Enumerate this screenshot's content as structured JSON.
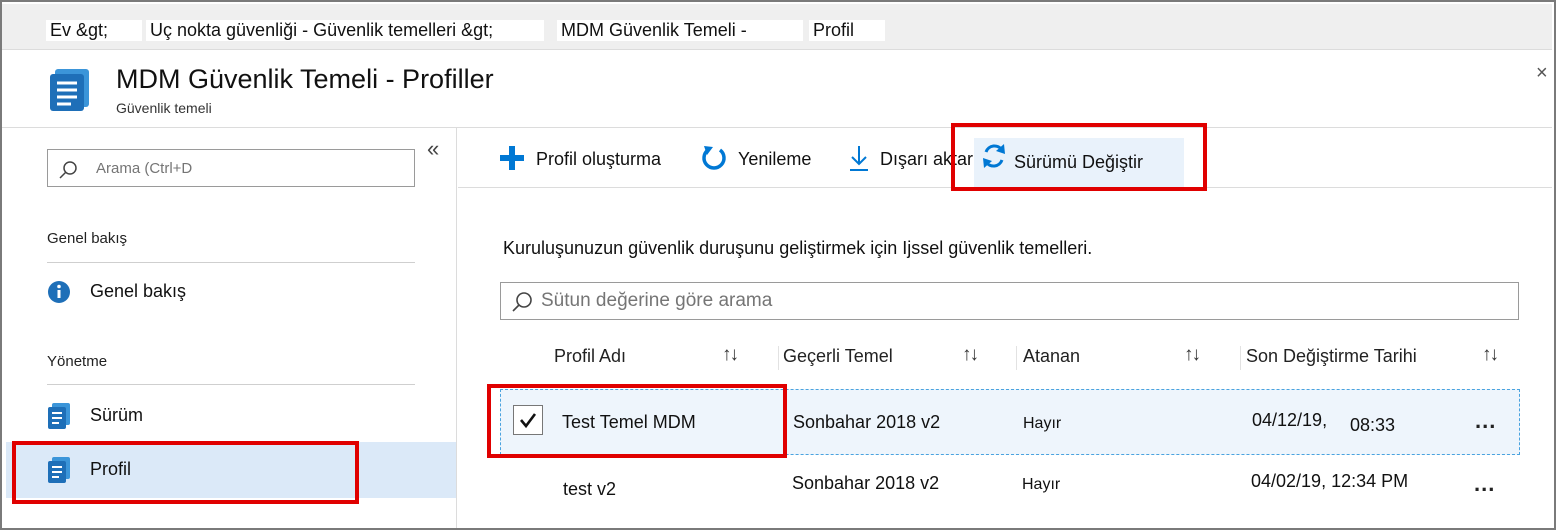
{
  "breadcrumb": {
    "home": "Ev &gt;",
    "endpoint": "Uç nokta güvenliği - Güvenlik temelleri &gt;",
    "baseline": "MDM Güvenlik Temeli -",
    "profile": "Profil"
  },
  "header": {
    "title": "MDM Güvenlik Temeli - Profiller",
    "subtitle": "Güvenlik temeli",
    "close": "×"
  },
  "sidebar": {
    "search_placeholder": "Arama (Ctrl+D",
    "collapse": "«",
    "section_overview": "Genel bakış",
    "overview_item": "Genel bakış",
    "section_manage": "Yönetme",
    "items": [
      {
        "label": "Sürüm"
      },
      {
        "label": "Profil"
      }
    ]
  },
  "toolbar": {
    "create": "Profil oluşturma",
    "refresh": "Yenileme",
    "export": "Dışarı aktarma",
    "change_version": "Sürümü Değiştir"
  },
  "main": {
    "description": "Kuruluşunuzun güvenlik duruşunu geliştirmek için Ijssel güvenlik temelleri.",
    "filter_placeholder": "Sütun değerine göre arama",
    "columns": [
      "Profil Adı",
      "Geçerli Temel",
      "Atanan",
      "Son Değiştirme Tarihi"
    ],
    "sort_glyph": "↑↓",
    "rows": [
      {
        "name": "Test Temel MDM",
        "baseline": "Sonbahar 2018 v2",
        "assigned": "Hayır",
        "date": "04/12/19,",
        "time": "08:33",
        "selected": true
      },
      {
        "name": "test v2",
        "baseline": "Sonbahar 2018 v2",
        "assigned": "Hayır",
        "date": "04/02/19, 12:34 PM",
        "time": "",
        "selected": false
      }
    ],
    "more": "..."
  },
  "colors": {
    "accent": "#0078d4",
    "highlight": "#e00000",
    "selected_bg": "#dbe9f8"
  }
}
